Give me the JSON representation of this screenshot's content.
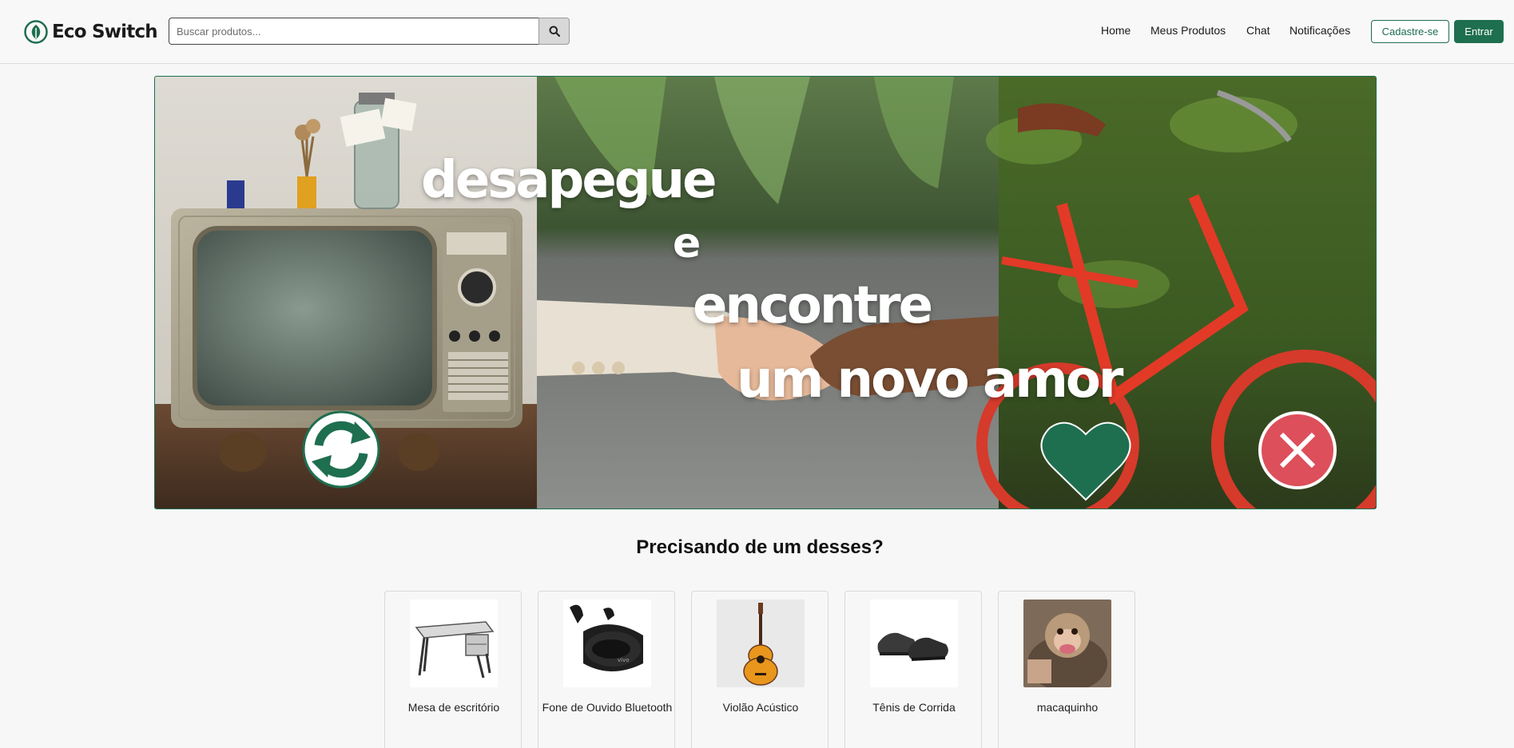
{
  "brand": {
    "name": "Eco Switch",
    "color": "#1e6e50",
    "logo_icon": "eco-leaf-icon"
  },
  "search": {
    "placeholder": "Buscar produtos...",
    "value": "",
    "button_icon": "search-icon"
  },
  "nav": {
    "links": [
      {
        "label": "Home"
      },
      {
        "label": "Meus Produtos"
      },
      {
        "label": "Chat"
      },
      {
        "label": "Notificações"
      }
    ],
    "signup_label": "Cadastre-se",
    "login_label": "Entrar"
  },
  "hero": {
    "lines": [
      "desapegue",
      "e",
      "encontre",
      "um novo amor"
    ],
    "icons": [
      "refresh-icon",
      "heart-icon",
      "close-icon"
    ]
  },
  "section": {
    "title": "Precisando de um desses?"
  },
  "products": [
    {
      "name": "Mesa de escritório",
      "image_icon": "desk-image"
    },
    {
      "name": "Fone de Ouvido Bluetooth",
      "image_icon": "earbuds-image"
    },
    {
      "name": "Violão Acústico",
      "image_icon": "guitar-image"
    },
    {
      "name": "Tênis de Corrida",
      "image_icon": "sneakers-image"
    },
    {
      "name": "macaquinho",
      "image_icon": "monkey-image"
    }
  ]
}
